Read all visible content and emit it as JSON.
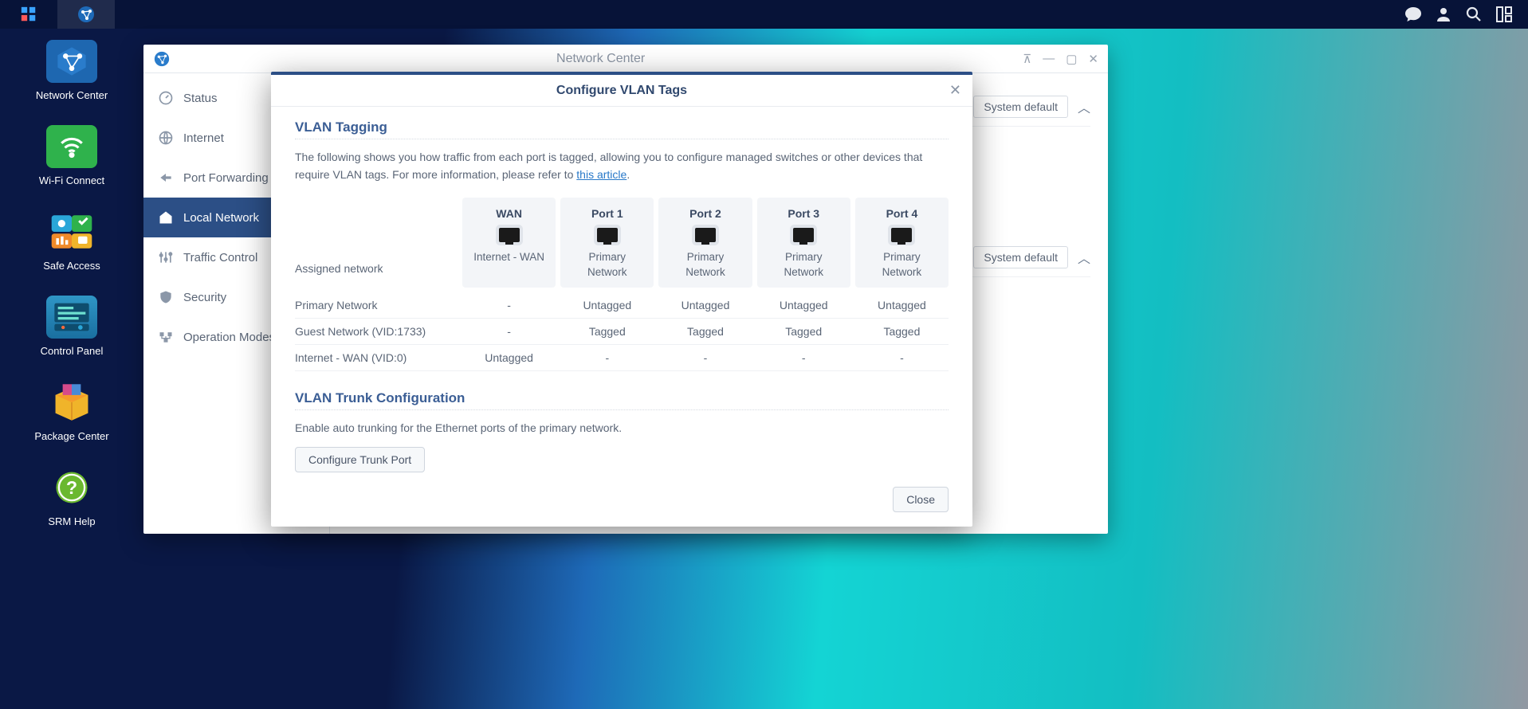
{
  "taskbar": {
    "tooltip": ""
  },
  "desktop": [
    {
      "label": "Network Center"
    },
    {
      "label": "Wi-Fi Connect"
    },
    {
      "label": "Safe Access"
    },
    {
      "label": "Control Panel"
    },
    {
      "label": "Package Center"
    },
    {
      "label": "SRM Help"
    }
  ],
  "window": {
    "title": "Network Center",
    "sidebar": [
      {
        "label": "Status"
      },
      {
        "label": "Internet"
      },
      {
        "label": "Port Forwarding"
      },
      {
        "label": "Local Network"
      },
      {
        "label": "Traffic Control"
      },
      {
        "label": "Security"
      },
      {
        "label": "Operation Modes"
      }
    ],
    "panel_default_1": "System default",
    "panel_default_2": "System default"
  },
  "modal": {
    "title": "Configure VLAN Tags",
    "section1_title": "VLAN Tagging",
    "desc_a": "The following shows you how traffic from each port is tagged, allowing you to configure managed switches or other devices that require VLAN tags. For more information, please refer to ",
    "desc_link": "this article",
    "desc_b": ".",
    "assigned_label": "Assigned network",
    "ports": [
      {
        "name": "WAN",
        "assigned": "Internet - WAN"
      },
      {
        "name": "Port 1",
        "assigned": "Primary Network"
      },
      {
        "name": "Port 2",
        "assigned": "Primary Network"
      },
      {
        "name": "Port 3",
        "assigned": "Primary Network"
      },
      {
        "name": "Port 4",
        "assigned": "Primary Network"
      }
    ],
    "rows": [
      {
        "label": "Primary Network",
        "cells": [
          "-",
          "Untagged",
          "Untagged",
          "Untagged",
          "Untagged"
        ]
      },
      {
        "label": "Guest Network (VID:1733)",
        "cells": [
          "-",
          "Tagged",
          "Tagged",
          "Tagged",
          "Tagged"
        ]
      },
      {
        "label": "Internet - WAN (VID:0)",
        "cells": [
          "Untagged",
          "-",
          "-",
          "-",
          "-"
        ]
      }
    ],
    "section2_title": "VLAN Trunk Configuration",
    "trunk_desc": "Enable auto trunking for the Ethernet ports of the primary network.",
    "trunk_btn": "Configure Trunk Port",
    "close_btn": "Close"
  }
}
